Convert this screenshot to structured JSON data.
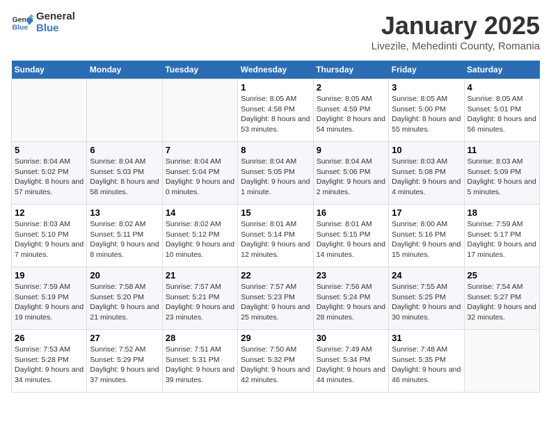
{
  "header": {
    "logo_line1": "General",
    "logo_line2": "Blue",
    "title": "January 2025",
    "subtitle": "Livezile, Mehedinti County, Romania"
  },
  "weekdays": [
    "Sunday",
    "Monday",
    "Tuesday",
    "Wednesday",
    "Thursday",
    "Friday",
    "Saturday"
  ],
  "weeks": [
    [
      {
        "day": "",
        "info": ""
      },
      {
        "day": "",
        "info": ""
      },
      {
        "day": "",
        "info": ""
      },
      {
        "day": "1",
        "info": "Sunrise: 8:05 AM\nSunset: 4:58 PM\nDaylight: 8 hours and 53 minutes."
      },
      {
        "day": "2",
        "info": "Sunrise: 8:05 AM\nSunset: 4:59 PM\nDaylight: 8 hours and 54 minutes."
      },
      {
        "day": "3",
        "info": "Sunrise: 8:05 AM\nSunset: 5:00 PM\nDaylight: 8 hours and 55 minutes."
      },
      {
        "day": "4",
        "info": "Sunrise: 8:05 AM\nSunset: 5:01 PM\nDaylight: 8 hours and 56 minutes."
      }
    ],
    [
      {
        "day": "5",
        "info": "Sunrise: 8:04 AM\nSunset: 5:02 PM\nDaylight: 8 hours and 57 minutes."
      },
      {
        "day": "6",
        "info": "Sunrise: 8:04 AM\nSunset: 5:03 PM\nDaylight: 8 hours and 58 minutes."
      },
      {
        "day": "7",
        "info": "Sunrise: 8:04 AM\nSunset: 5:04 PM\nDaylight: 9 hours and 0 minutes."
      },
      {
        "day": "8",
        "info": "Sunrise: 8:04 AM\nSunset: 5:05 PM\nDaylight: 9 hours and 1 minute."
      },
      {
        "day": "9",
        "info": "Sunrise: 8:04 AM\nSunset: 5:06 PM\nDaylight: 9 hours and 2 minutes."
      },
      {
        "day": "10",
        "info": "Sunrise: 8:03 AM\nSunset: 5:08 PM\nDaylight: 9 hours and 4 minutes."
      },
      {
        "day": "11",
        "info": "Sunrise: 8:03 AM\nSunset: 5:09 PM\nDaylight: 9 hours and 5 minutes."
      }
    ],
    [
      {
        "day": "12",
        "info": "Sunrise: 8:03 AM\nSunset: 5:10 PM\nDaylight: 9 hours and 7 minutes."
      },
      {
        "day": "13",
        "info": "Sunrise: 8:02 AM\nSunset: 5:11 PM\nDaylight: 9 hours and 8 minutes."
      },
      {
        "day": "14",
        "info": "Sunrise: 8:02 AM\nSunset: 5:12 PM\nDaylight: 9 hours and 10 minutes."
      },
      {
        "day": "15",
        "info": "Sunrise: 8:01 AM\nSunset: 5:14 PM\nDaylight: 9 hours and 12 minutes."
      },
      {
        "day": "16",
        "info": "Sunrise: 8:01 AM\nSunset: 5:15 PM\nDaylight: 9 hours and 14 minutes."
      },
      {
        "day": "17",
        "info": "Sunrise: 8:00 AM\nSunset: 5:16 PM\nDaylight: 9 hours and 15 minutes."
      },
      {
        "day": "18",
        "info": "Sunrise: 7:59 AM\nSunset: 5:17 PM\nDaylight: 9 hours and 17 minutes."
      }
    ],
    [
      {
        "day": "19",
        "info": "Sunrise: 7:59 AM\nSunset: 5:19 PM\nDaylight: 9 hours and 19 minutes."
      },
      {
        "day": "20",
        "info": "Sunrise: 7:58 AM\nSunset: 5:20 PM\nDaylight: 9 hours and 21 minutes."
      },
      {
        "day": "21",
        "info": "Sunrise: 7:57 AM\nSunset: 5:21 PM\nDaylight: 9 hours and 23 minutes."
      },
      {
        "day": "22",
        "info": "Sunrise: 7:57 AM\nSunset: 5:23 PM\nDaylight: 9 hours and 25 minutes."
      },
      {
        "day": "23",
        "info": "Sunrise: 7:56 AM\nSunset: 5:24 PM\nDaylight: 9 hours and 28 minutes."
      },
      {
        "day": "24",
        "info": "Sunrise: 7:55 AM\nSunset: 5:25 PM\nDaylight: 9 hours and 30 minutes."
      },
      {
        "day": "25",
        "info": "Sunrise: 7:54 AM\nSunset: 5:27 PM\nDaylight: 9 hours and 32 minutes."
      }
    ],
    [
      {
        "day": "26",
        "info": "Sunrise: 7:53 AM\nSunset: 5:28 PM\nDaylight: 9 hours and 34 minutes."
      },
      {
        "day": "27",
        "info": "Sunrise: 7:52 AM\nSunset: 5:29 PM\nDaylight: 9 hours and 37 minutes."
      },
      {
        "day": "28",
        "info": "Sunrise: 7:51 AM\nSunset: 5:31 PM\nDaylight: 9 hours and 39 minutes."
      },
      {
        "day": "29",
        "info": "Sunrise: 7:50 AM\nSunset: 5:32 PM\nDaylight: 9 hours and 42 minutes."
      },
      {
        "day": "30",
        "info": "Sunrise: 7:49 AM\nSunset: 5:34 PM\nDaylight: 9 hours and 44 minutes."
      },
      {
        "day": "31",
        "info": "Sunrise: 7:48 AM\nSunset: 5:35 PM\nDaylight: 9 hours and 46 minutes."
      },
      {
        "day": "",
        "info": ""
      }
    ]
  ]
}
